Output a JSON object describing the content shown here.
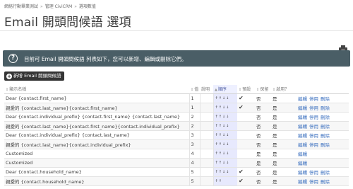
{
  "breadcrumb": [
    "網絡行動畢業測試",
    "管理 CiviCRM",
    "選項數值"
  ],
  "page_title": "Email 開頭問候語 選項",
  "help_text": "目前可 Email 開頭問候語 列表如下，您可以新增、編輯或刪除它們。",
  "add_button_label": "新增 Email 開頭問候語",
  "table": {
    "headers": {
      "label": "顯示名稱",
      "weight": "值",
      "desc": "說明",
      "order": "順序",
      "default": "預設",
      "reserved": "保留",
      "enabled": "啟用？"
    },
    "rows": [
      {
        "label": "Dear {contact.first_name}",
        "value": "1",
        "order": "↑↑↓↓",
        "default": "✔",
        "reserved": "否",
        "enabled": "是",
        "actions": [
          "編輯",
          "停用",
          "刪除"
        ]
      },
      {
        "label": "親愛的 {contact.last_name}{contact.first_name}",
        "value": "1",
        "order": "↑↑↓↓",
        "default": "✔",
        "reserved": "否",
        "enabled": "是",
        "actions": [
          "編輯",
          "停用",
          "刪除"
        ]
      },
      {
        "label": "Dear {contact.individual_prefix} {contact.first_name} {contact.last_name}",
        "value": "2",
        "order": "↑↑↓↓",
        "default": "",
        "reserved": "否",
        "enabled": "是",
        "actions": [
          "編輯",
          "停用",
          "刪除"
        ]
      },
      {
        "label": "親愛的 {contact.last_name}{contact.first_name}{contact.individual_prefix}",
        "value": "2",
        "order": "↑↑↓↓",
        "default": "",
        "reserved": "否",
        "enabled": "是",
        "actions": [
          "編輯",
          "停用",
          "刪除"
        ]
      },
      {
        "label": "Dear {contact.individual_prefix} {contact.last_name}",
        "value": "3",
        "order": "↑↑↓↓",
        "default": "",
        "reserved": "否",
        "enabled": "是",
        "actions": [
          "編輯",
          "停用",
          "刪除"
        ]
      },
      {
        "label": "親愛的 {contact.last_name}{contact.individual_prefix}",
        "value": "3",
        "order": "↑↑↓↓",
        "default": "",
        "reserved": "否",
        "enabled": "是",
        "actions": [
          "編輯",
          "停用",
          "刪除"
        ]
      },
      {
        "label": "Customized",
        "value": "4",
        "order": "↑↑↓↓",
        "default": "",
        "reserved": "是",
        "enabled": "是",
        "actions": [
          "編輯"
        ]
      },
      {
        "label": "Customized",
        "value": "4",
        "order": "↑↑↓↓",
        "default": "",
        "reserved": "是",
        "enabled": "是",
        "actions": [
          "編輯"
        ]
      },
      {
        "label": "Dear {contact.household_name}",
        "value": "5",
        "order": "↑↑↓↓",
        "default": "✔",
        "reserved": "否",
        "enabled": "是",
        "actions": [
          "編輯",
          "停用",
          "刪除"
        ]
      },
      {
        "label": "親愛的 {contact.household_name}",
        "value": "5",
        "order": "↑↑",
        "default": "✔",
        "reserved": "否",
        "enabled": "是",
        "actions": [
          "編輯",
          "停用",
          "刪除"
        ]
      }
    ]
  },
  "colors": {
    "help_bar": "#4a5e66",
    "add_button": "#353535",
    "link": "#3a6fbf",
    "check": "#49a02e",
    "order_column": "#e7e9fd"
  },
  "icons": {
    "help": "question-circle-icon",
    "print": "printer-icon",
    "add": "plus-circle-icon",
    "sort": "sort-icon"
  }
}
